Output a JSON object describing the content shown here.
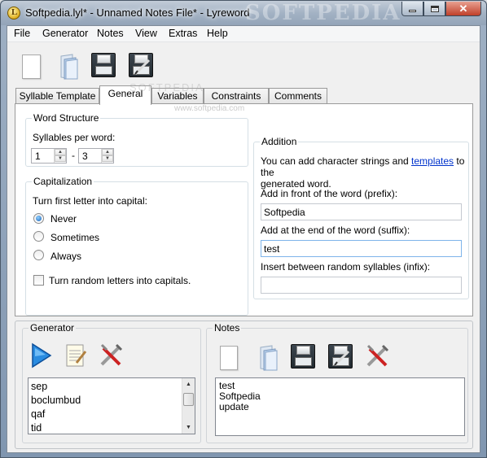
{
  "window": {
    "title": "Softpedia.lyl* - Unnamed Notes File* - Lyreword",
    "watermark": "SOFTPEDIA",
    "app_icon_glyph": "L"
  },
  "menu": [
    "File",
    "Generator",
    "Notes",
    "View",
    "Extras",
    "Help"
  ],
  "toolbar": {
    "icons": [
      "new-document-icon",
      "open-folder-icon",
      "save-icon",
      "save-as-icon"
    ]
  },
  "tabs": [
    {
      "label": "Syllable Template",
      "active": false
    },
    {
      "label": "General",
      "active": true
    },
    {
      "label": "Variables",
      "active": false
    },
    {
      "label": "Constraints",
      "active": false
    },
    {
      "label": "Comments",
      "active": false
    }
  ],
  "tab_watermark": "SOFTPEDIA",
  "tab_watermark_url": "www.softpedia.com",
  "word_structure": {
    "title": "Word Structure",
    "syllables_label": "Syllables per word:",
    "min": "1",
    "separator": "-",
    "max": "3"
  },
  "capitalization": {
    "title": "Capitalization",
    "first_letter_label": "Turn first letter into capital:",
    "options": [
      {
        "label": "Never",
        "checked": true
      },
      {
        "label": "Sometimes",
        "checked": false
      },
      {
        "label": "Always",
        "checked": false
      }
    ],
    "random_label": "Turn random letters into capitals.",
    "random_checked": false
  },
  "addition": {
    "title": "Addition",
    "desc_before": "You can add character strings and ",
    "desc_link": "templates",
    "desc_after": " to the",
    "desc_line2": "generated word.",
    "prefix_label": "Add in front of the word (prefix):",
    "prefix_value": "Softpedia",
    "suffix_label": "Add at the end of the word (suffix):",
    "suffix_value": "test",
    "infix_label": "Insert between random syllables (infix):",
    "infix_value": ""
  },
  "generator": {
    "title": "Generator",
    "icons": [
      "play-icon",
      "notepad-icon",
      "tools-icon"
    ],
    "items": [
      "sep",
      "boclumbud",
      "qaf",
      "tid"
    ]
  },
  "notes": {
    "title": "Notes",
    "icons": [
      "new-note-icon",
      "open-folder-icon",
      "save-icon",
      "save-as-icon",
      "tools-icon"
    ],
    "lines": [
      "test",
      "Softpedia",
      "update"
    ]
  },
  "colors": {
    "accent": "#1a62b8",
    "link": "#0033cc"
  }
}
